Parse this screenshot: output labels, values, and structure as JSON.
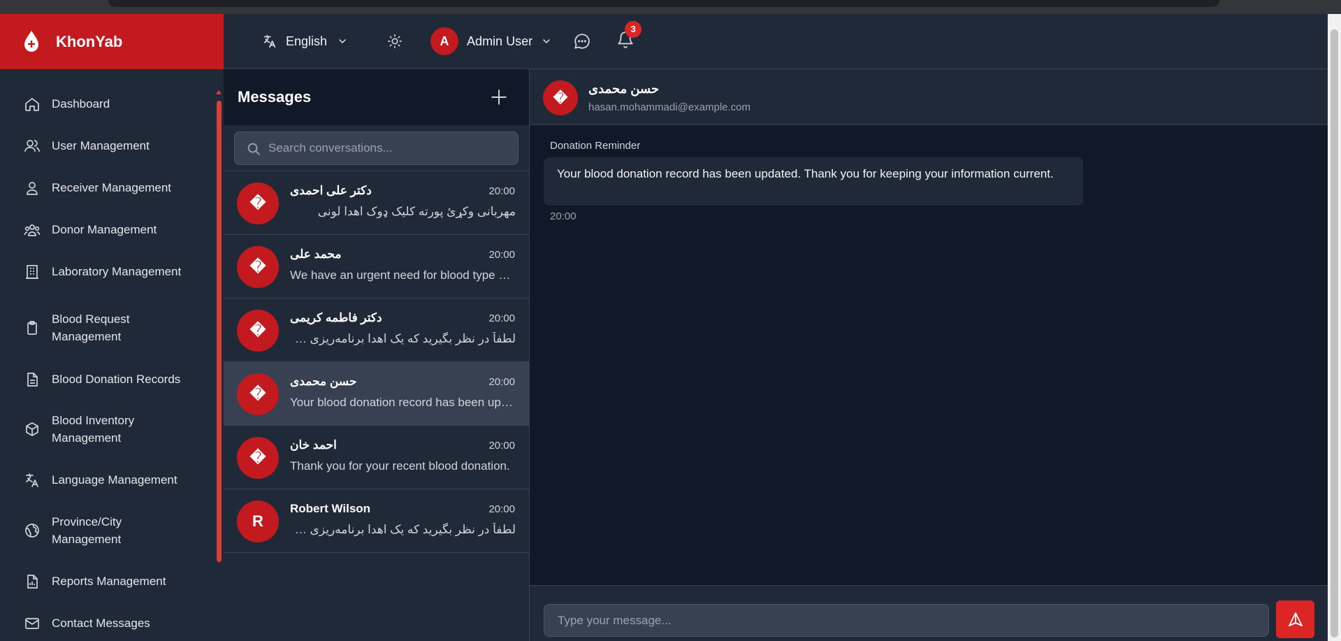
{
  "brand": {
    "name": "KhonYab"
  },
  "topbar": {
    "language": "English",
    "user_initial": "A",
    "user_name": "Admin User",
    "notification_count": "3"
  },
  "sidebar": {
    "items": [
      {
        "label": "Dashboard",
        "icon": "home-icon"
      },
      {
        "label": "User Management",
        "icon": "users-icon"
      },
      {
        "label": "Receiver Management",
        "icon": "user-icon"
      },
      {
        "label": "Donor Management",
        "icon": "group-icon"
      },
      {
        "label": "Laboratory Management",
        "icon": "building-icon"
      },
      {
        "label": "Blood Request Management",
        "icon": "clipboard-icon"
      },
      {
        "label": "Blood Donation Records",
        "icon": "document-icon"
      },
      {
        "label": "Blood Inventory Management",
        "icon": "cube-icon"
      },
      {
        "label": "Language Management",
        "icon": "translate-icon"
      },
      {
        "label": "Province/City Management",
        "icon": "globe-icon"
      },
      {
        "label": "Reports Management",
        "icon": "report-icon"
      },
      {
        "label": "Contact Messages",
        "icon": "mail-icon"
      }
    ]
  },
  "conversations": {
    "title": "Messages",
    "search_placeholder": "Search conversations...",
    "items": [
      {
        "avatar": "�",
        "name": "دکتر علی احمدی",
        "time": "20:00",
        "preview": "مهربانی وکړئ پورته کلیک ډوک اهدا لونی"
      },
      {
        "avatar": "�",
        "name": "محمد علی",
        "time": "20:00",
        "preview": "We have an urgent need for blood type O-negative"
      },
      {
        "avatar": "�",
        "name": "دکتر فاطمه کریمی",
        "time": "20:00",
        "preview": "لطفاً در نظر بگیرید که یک اهدا برنامه‌ریزی کنید"
      },
      {
        "avatar": "�",
        "name": "حسن محمدی",
        "time": "20:00",
        "preview": "Your blood donation record has been updated."
      },
      {
        "avatar": "�",
        "name": "احمد خان",
        "time": "20:00",
        "preview": "Thank you for your recent blood donation."
      },
      {
        "avatar": "R",
        "name": "Robert Wilson",
        "time": "20:00",
        "preview": "لطفاً در نظر بگیرید که یک اهدا برنامه‌ریزی کنید"
      }
    ]
  },
  "chat": {
    "avatar": "�",
    "name": "حسن محمدی",
    "email": "hasan.mohammadi@example.com",
    "message": {
      "subject": "Donation Reminder",
      "text": "Your blood donation record has been updated. Thank you for keeping your information current.",
      "time": "20:00"
    },
    "input_placeholder": "Type your message..."
  },
  "colors": {
    "brand": "#c21a1f",
    "accent": "#dc2626"
  }
}
